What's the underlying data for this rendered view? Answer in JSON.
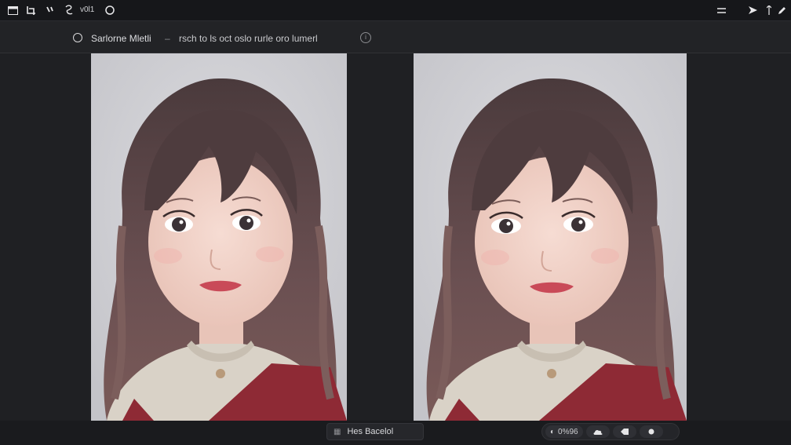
{
  "toolbar": {
    "left_icons": [
      "window-icon",
      "crop-icon",
      "brush-icon",
      "lasso-icon"
    ],
    "version_text": "v0l1",
    "right_icons": [
      "menu-icon",
      "send-icon",
      "pin-icon",
      "pencil-icon"
    ]
  },
  "header": {
    "title": "Sarlorne Mletli",
    "separator": "–",
    "description": "rsch to ls oct oslo rurle oro lumerl",
    "info_icon": "info-icon"
  },
  "images": {
    "left": {
      "name": "portrait-original"
    },
    "right": {
      "name": "portrait-result"
    }
  },
  "status": {
    "label": "Hes Bacelol"
  },
  "controls": {
    "zoom_label": "0%96",
    "buttons": [
      "cloud-icon",
      "tag-icon",
      "record-icon"
    ]
  },
  "colors": {
    "background": "#1f2023",
    "topbar": "#16171a",
    "panel_bg": "#cfcfd3",
    "hair": "#5a4546",
    "sweater": "#d9d2c7",
    "vest": "#8e2a35"
  }
}
